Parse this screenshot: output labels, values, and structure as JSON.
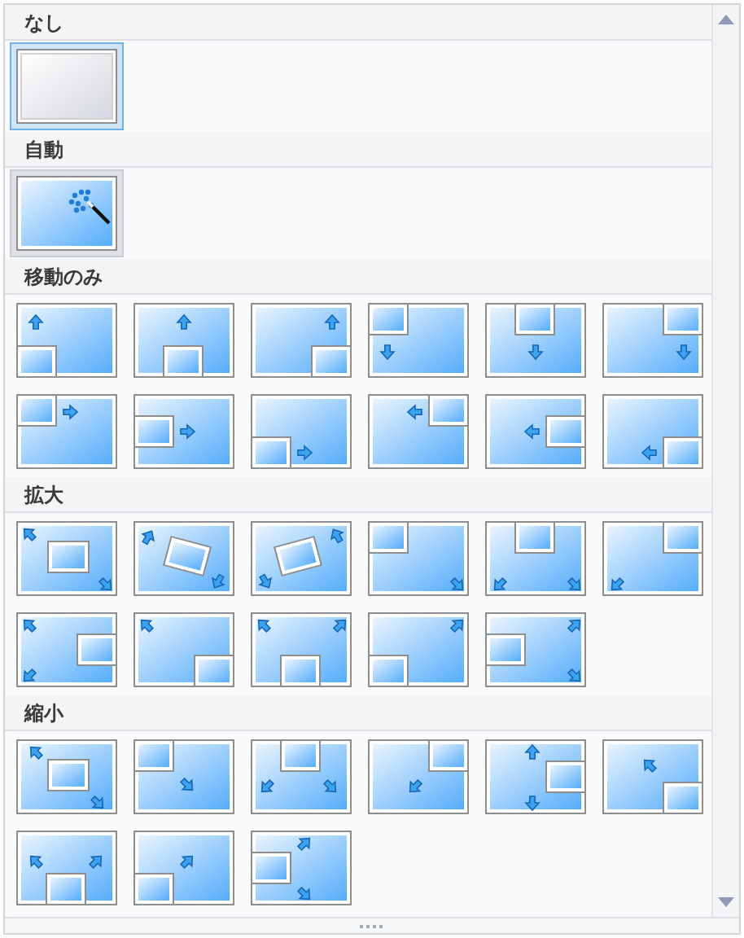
{
  "sections": [
    {
      "title": "なし",
      "kind": "none",
      "items": [
        {
          "selected": true,
          "hovered": false
        }
      ]
    },
    {
      "title": "自動",
      "kind": "auto",
      "items": [
        {
          "selected": false,
          "hovered": true
        }
      ]
    },
    {
      "title": "移動のみ",
      "kind": "pan",
      "items": [
        {
          "selected": false,
          "hovered": false
        },
        {
          "selected": false,
          "hovered": false
        },
        {
          "selected": false,
          "hovered": false
        },
        {
          "selected": false,
          "hovered": false
        },
        {
          "selected": false,
          "hovered": false
        },
        {
          "selected": false,
          "hovered": false
        },
        {
          "selected": false,
          "hovered": false
        },
        {
          "selected": false,
          "hovered": false
        },
        {
          "selected": false,
          "hovered": false
        },
        {
          "selected": false,
          "hovered": false
        },
        {
          "selected": false,
          "hovered": false
        },
        {
          "selected": false,
          "hovered": false
        }
      ]
    },
    {
      "title": "拡大",
      "kind": "zoom_in",
      "items": [
        {
          "selected": false,
          "hovered": false
        },
        {
          "selected": false,
          "hovered": false
        },
        {
          "selected": false,
          "hovered": false
        },
        {
          "selected": false,
          "hovered": false
        },
        {
          "selected": false,
          "hovered": false
        },
        {
          "selected": false,
          "hovered": false
        },
        {
          "selected": false,
          "hovered": false
        },
        {
          "selected": false,
          "hovered": false
        },
        {
          "selected": false,
          "hovered": false
        },
        {
          "selected": false,
          "hovered": false
        },
        {
          "selected": false,
          "hovered": false
        }
      ]
    },
    {
      "title": "縮小",
      "kind": "zoom_out",
      "items": [
        {
          "selected": false,
          "hovered": false
        },
        {
          "selected": false,
          "hovered": false
        },
        {
          "selected": false,
          "hovered": false
        },
        {
          "selected": false,
          "hovered": false
        },
        {
          "selected": false,
          "hovered": false
        },
        {
          "selected": false,
          "hovered": false
        },
        {
          "selected": false,
          "hovered": false
        },
        {
          "selected": false,
          "hovered": false
        },
        {
          "selected": false,
          "hovered": false
        }
      ]
    }
  ]
}
